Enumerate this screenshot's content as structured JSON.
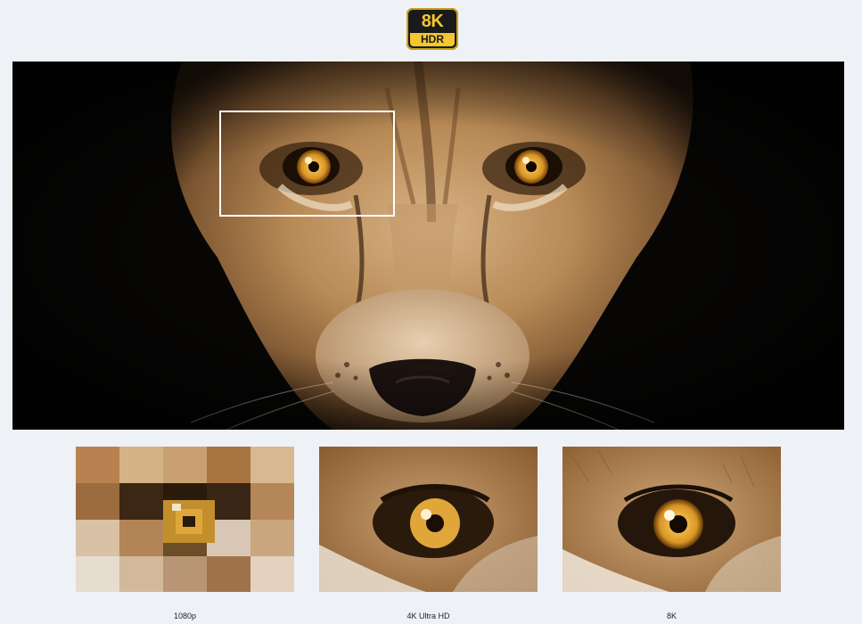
{
  "badge": {
    "top_text": "8K",
    "bottom_text": "HDR",
    "accent": "#f3c632"
  },
  "hero": {
    "subject": "lioness-face",
    "highlight": "eye-region"
  },
  "comparison": [
    {
      "label": "1080p"
    },
    {
      "label": "4K Ultra HD"
    },
    {
      "label": "8K"
    }
  ],
  "colors": {
    "background": "#eef2f7",
    "fur": "#b88a55",
    "eye": "#e0a63a"
  }
}
